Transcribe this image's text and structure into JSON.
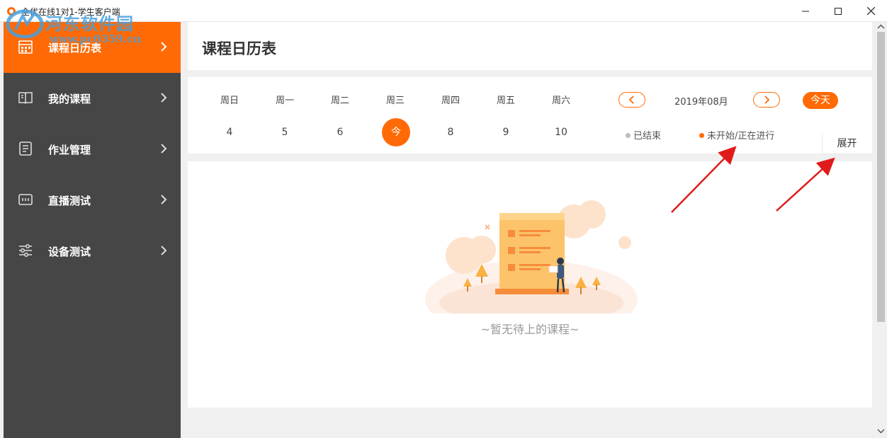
{
  "window": {
    "title": "全优在线1对1-学生客户端"
  },
  "watermark": {
    "title": "河东软件园",
    "url": "www.pc0359.cn"
  },
  "sidebar": {
    "items": [
      {
        "label": "课程日历表",
        "icon": "calendar-icon",
        "active": true
      },
      {
        "label": "我的课程",
        "icon": "book-icon",
        "active": false
      },
      {
        "label": "作业管理",
        "icon": "document-icon",
        "active": false
      },
      {
        "label": "直播测试",
        "icon": "monitor-icon",
        "active": false
      },
      {
        "label": "设备测试",
        "icon": "sliders-icon",
        "active": false
      }
    ]
  },
  "header": {
    "title": "课程日历表"
  },
  "calendar": {
    "weekdays": [
      "周日",
      "周一",
      "周二",
      "周三",
      "周四",
      "周五",
      "周六"
    ],
    "days": [
      "4",
      "5",
      "6",
      "今",
      "8",
      "9",
      "10"
    ],
    "selected_index": 3,
    "month": "2019年08月",
    "today_label": "今天",
    "legend": [
      {
        "label": "已结束",
        "color": "#bdbdbd"
      },
      {
        "label": "未开始/正在进行",
        "color": "#ff6a06"
      }
    ],
    "expand_label": "展开"
  },
  "main": {
    "empty_text": "~暂无待上的课程~"
  },
  "colors": {
    "accent": "#ff6a06",
    "sidebar_bg": "#464646",
    "annotation_arrow": "#e01b1b"
  }
}
